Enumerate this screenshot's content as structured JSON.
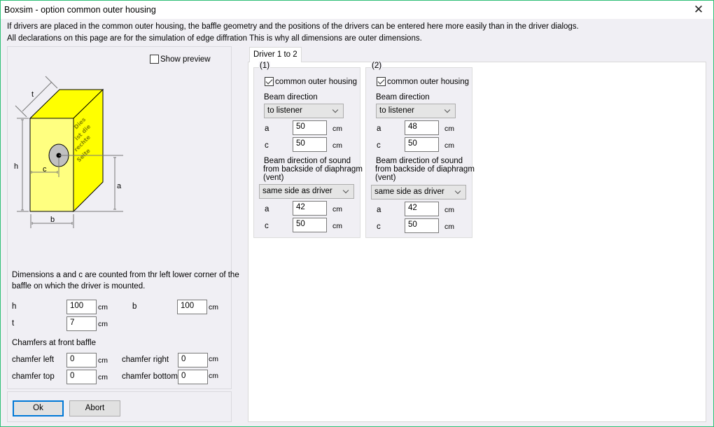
{
  "window": {
    "title": "Boxsim - option common outer housing",
    "close_icon": "close-x-icon"
  },
  "info": {
    "line1": "If drivers are placed in the common outer housing,  the baffle geometry and the positions of the drivers can be entered here more easily than in the driver dialogs.",
    "line2": "All declarations on this page are for the simulation of edge diffration This is why all dimensions are outer dimensions."
  },
  "preview": {
    "show_preview_label": "Show preview",
    "show_preview_checked": false
  },
  "diagram": {
    "labels": {
      "t": "t",
      "h": "h",
      "c": "c",
      "a": "a",
      "b": "b"
    },
    "side_text": [
      "Dies",
      "ist die",
      "rechte",
      "Seite"
    ],
    "colors": {
      "front": "#ffff80",
      "side": "#ffff00",
      "driver": "#c0c0c0",
      "side_text": "#8a8a00"
    }
  },
  "dimensions": {
    "note_line1": "Dimensions a and c are counted from thr left lower corner of the",
    "note_line2": "baffle on which the driver is mounted.",
    "h": {
      "label": "h",
      "value": "100",
      "unit": "cm"
    },
    "b": {
      "label": "b",
      "value": "100",
      "unit": "cm"
    },
    "t": {
      "label": "t",
      "value": "7",
      "unit": "cm"
    },
    "chamfers_title": "Chamfers at front baffle",
    "chamfer_left": {
      "label": "chamfer left",
      "value": "0",
      "unit": "cm"
    },
    "chamfer_right": {
      "label": "chamfer right",
      "value": "0",
      "unit": "cm"
    },
    "chamfer_top": {
      "label": "chamfer top",
      "value": "0",
      "unit": "cm"
    },
    "chamfer_bottom": {
      "label": "chamfer bottom",
      "value": "0",
      "unit": "cm"
    }
  },
  "buttons": {
    "ok": "Ok",
    "abort": "Abort"
  },
  "tabs": [
    {
      "label": "Driver 1 to 2",
      "active": true
    }
  ],
  "drivers": [
    {
      "legend": "(1)",
      "common_housing_label": "common outer housing",
      "common_housing_checked": true,
      "beam_direction_label": "Beam direction",
      "beam_direction_value": "to listener",
      "a": {
        "label": "a",
        "value": "50",
        "unit": "cm"
      },
      "c": {
        "label": "c",
        "value": "50",
        "unit": "cm"
      },
      "vent_label_1": "Beam direction of sound",
      "vent_label_2": "from backside of diaphragm",
      "vent_label_3": "(vent)",
      "vent_direction_value": "same side as driver",
      "vent_a": {
        "label": "a",
        "value": "42",
        "unit": "cm"
      },
      "vent_c": {
        "label": "c",
        "value": "50",
        "unit": "cm"
      }
    },
    {
      "legend": "(2)",
      "common_housing_label": "common outer housing",
      "common_housing_checked": true,
      "beam_direction_label": "Beam direction",
      "beam_direction_value": "to listener",
      "a": {
        "label": "a",
        "value": "48",
        "unit": "cm"
      },
      "c": {
        "label": "c",
        "value": "50",
        "unit": "cm"
      },
      "vent_label_1": "Beam direction of sound",
      "vent_label_2": "from backside of diaphragm",
      "vent_label_3": "(vent)",
      "vent_direction_value": "same side as driver",
      "vent_a": {
        "label": "a",
        "value": "42",
        "unit": "cm"
      },
      "vent_c": {
        "label": "c",
        "value": "50",
        "unit": "cm"
      }
    }
  ]
}
